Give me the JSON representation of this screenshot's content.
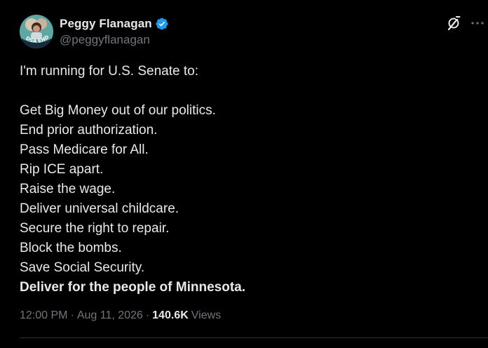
{
  "author": {
    "display_name": "Peggy Flanagan",
    "handle": "@peggyflanagan",
    "avatar_badge_text": "DSA ENDORSED"
  },
  "icons": {
    "verified": "verified-badge-icon",
    "grok": "grok-icon",
    "more": "more-options-icon"
  },
  "tweet": {
    "lines": [
      "I'm running for U.S. Senate to:",
      "",
      "Get Big Money out of our politics.",
      "End prior authorization.",
      "Pass Medicare for All.",
      "Rip ICE apart.",
      "Raise the wage.",
      "Deliver universal childcare.",
      "Secure the right to repair.",
      "Block the bombs.",
      "Save Social Security.",
      "Deliver for the people of Minnesota."
    ]
  },
  "meta": {
    "time": "12:00 PM",
    "separator": "·",
    "date": "Aug 11, 2026",
    "views_count": "140.6K",
    "views_label": "Views"
  },
  "colors": {
    "background": "#000000",
    "text_primary": "#e7e9ea",
    "text_secondary": "#71767b",
    "verified_blue": "#1d9bf0",
    "divider": "#2f3336"
  }
}
